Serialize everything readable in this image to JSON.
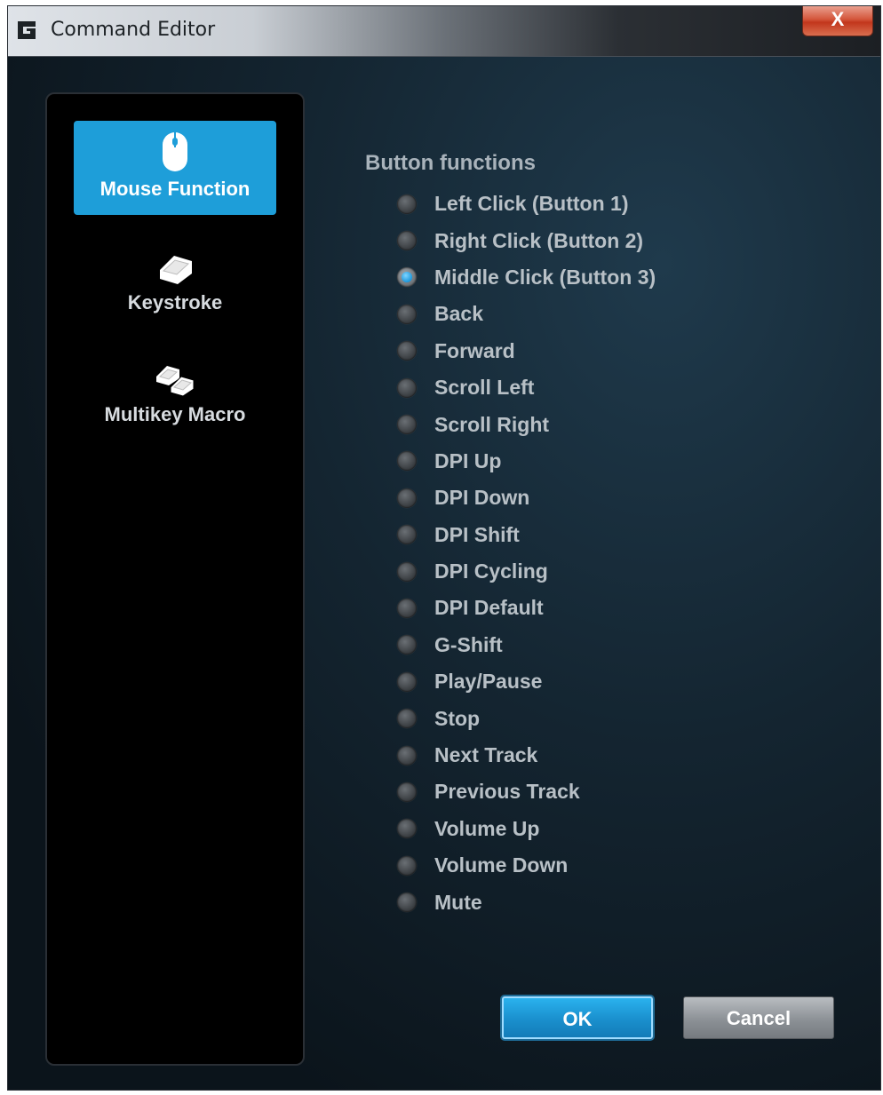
{
  "window": {
    "title": "Command Editor",
    "close_label": "X"
  },
  "sidebar": {
    "items": [
      {
        "label": "Mouse Function",
        "icon": "mouse-icon",
        "active": true
      },
      {
        "label": "Keystroke",
        "icon": "key-icon",
        "active": false
      },
      {
        "label": "Multikey Macro",
        "icon": "multikey-icon",
        "active": false
      }
    ]
  },
  "main": {
    "section_title": "Button functions",
    "options": [
      {
        "label": "Left Click (Button 1)",
        "checked": false
      },
      {
        "label": "Right Click (Button 2)",
        "checked": false
      },
      {
        "label": "Middle Click (Button 3)",
        "checked": true
      },
      {
        "label": "Back",
        "checked": false
      },
      {
        "label": "Forward",
        "checked": false
      },
      {
        "label": "Scroll Left",
        "checked": false
      },
      {
        "label": "Scroll Right",
        "checked": false
      },
      {
        "label": "DPI Up",
        "checked": false
      },
      {
        "label": "DPI Down",
        "checked": false
      },
      {
        "label": "DPI Shift",
        "checked": false
      },
      {
        "label": "DPI Cycling",
        "checked": false
      },
      {
        "label": "DPI Default",
        "checked": false
      },
      {
        "label": "G-Shift",
        "checked": false
      },
      {
        "label": "Play/Pause",
        "checked": false
      },
      {
        "label": "Stop",
        "checked": false
      },
      {
        "label": "Next Track",
        "checked": false
      },
      {
        "label": "Previous Track",
        "checked": false
      },
      {
        "label": "Volume Up",
        "checked": false
      },
      {
        "label": "Volume Down",
        "checked": false
      },
      {
        "label": "Mute",
        "checked": false
      }
    ]
  },
  "buttons": {
    "ok_label": "OK",
    "cancel_label": "Cancel"
  },
  "colors": {
    "accent": "#1e9ed9",
    "background": "#0d1117",
    "text": "#b8c0c6"
  }
}
